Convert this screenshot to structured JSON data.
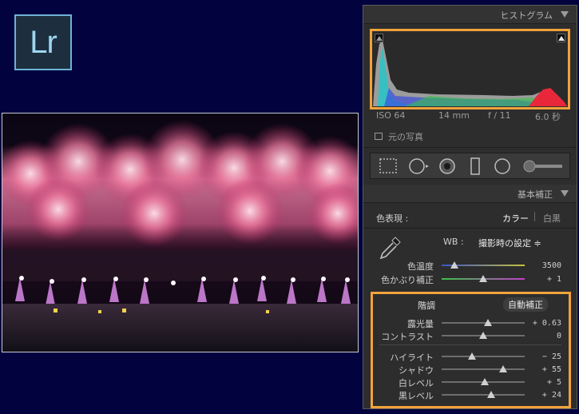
{
  "logo": {
    "text": "Lr"
  },
  "histogram": {
    "header": "ヒストグラム",
    "iso": "ISO 64",
    "focal": "14 mm",
    "aperture": "f / 11",
    "shutter": "6.0 秒",
    "original_photo_label": "元の写真"
  },
  "basic": {
    "header": "基本補正",
    "treatment_label": "色表現 :",
    "treatment_options": [
      "カラー",
      "白黒"
    ],
    "wb_label": "WB :",
    "wb_value": "撮影時の設定 ≑",
    "temp": {
      "label": "色温度",
      "value": "3500",
      "level": 0.15
    },
    "tint": {
      "label": "色かぶり補正",
      "value": "+ 1",
      "level": 0.5
    },
    "tone_label": "階調",
    "auto_label": "自動補正",
    "sliders": [
      {
        "label": "露光量",
        "value": "+ 0.63",
        "level": 0.56
      },
      {
        "label": "コントラスト",
        "value": "0",
        "level": 0.5
      }
    ],
    "sliders2": [
      {
        "label": "ハイライト",
        "value": "− 25",
        "level": 0.37
      },
      {
        "label": "シャドウ",
        "value": "+ 55",
        "level": 0.74
      },
      {
        "label": "白レベル",
        "value": "+ 5",
        "level": 0.52
      },
      {
        "label": "黒レベル",
        "value": "+ 24",
        "level": 0.6
      }
    ]
  },
  "colors": {
    "accent": "#f2a23b",
    "panel": "#2d2d2d",
    "background": "#02023e"
  }
}
